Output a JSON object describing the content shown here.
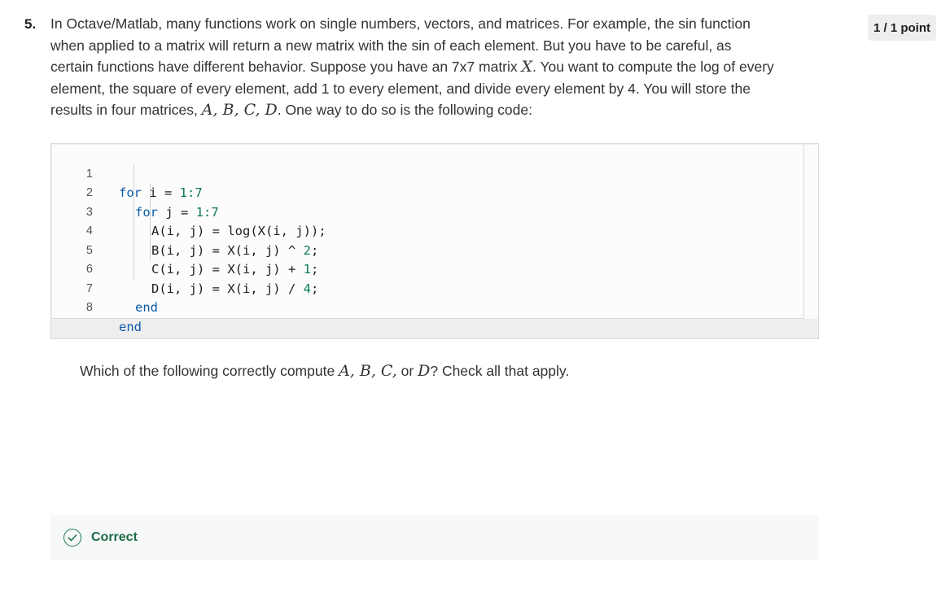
{
  "question": {
    "number": "5.",
    "points": "1 / 1 point",
    "prompt": {
      "l1": "In Octave/Matlab, many functions work on single numbers, vectors, and matrices. For example, the sin function",
      "l2": "when applied to a matrix will return a new matrix with the sin of each element. But you have to be careful, as",
      "l3a": "certain functions have different behavior. Suppose you have an 7x7 matrix ",
      "l3x": "X",
      "l3b": ". You want to compute the log of every",
      "l4": "element, the square of every element, add 1 to every element, and divide every element by 4. You will store the",
      "l5a": "results in four matrices, ",
      "l5m": "A, B, C, D",
      "l5b": ". One way to do so is the following code:"
    },
    "sub_prompt": {
      "a": "Which of the following correctly compute ",
      "m": "A, B, C,",
      "b": " or ",
      "d": "D",
      "c": "? Check all that apply."
    }
  },
  "code": {
    "line_numbers": [
      "1",
      "2",
      "3",
      "4",
      "5",
      "6",
      "7",
      "8"
    ],
    "l1": {
      "kw": "for",
      "var": " i = ",
      "num": "1:7"
    },
    "l2": {
      "kw": "for",
      "var": " j = ",
      "num": "1:7"
    },
    "l3": "A(i, j) = log(X(i, j));",
    "l4a": "B(i, j) = X(i, j) ^ ",
    "l4n": "2",
    "l4b": ";",
    "l5a": "C(i, j) = X(i, j) + ",
    "l5n": "1",
    "l5b": ";",
    "l6a": "D(i, j) = X(i, j) / ",
    "l6n": "4",
    "l6b": ";",
    "l7": "end",
    "l8": "end"
  },
  "feedback": {
    "status": "Correct",
    "icon": "check-circle-icon",
    "color": "#1c6b46"
  }
}
